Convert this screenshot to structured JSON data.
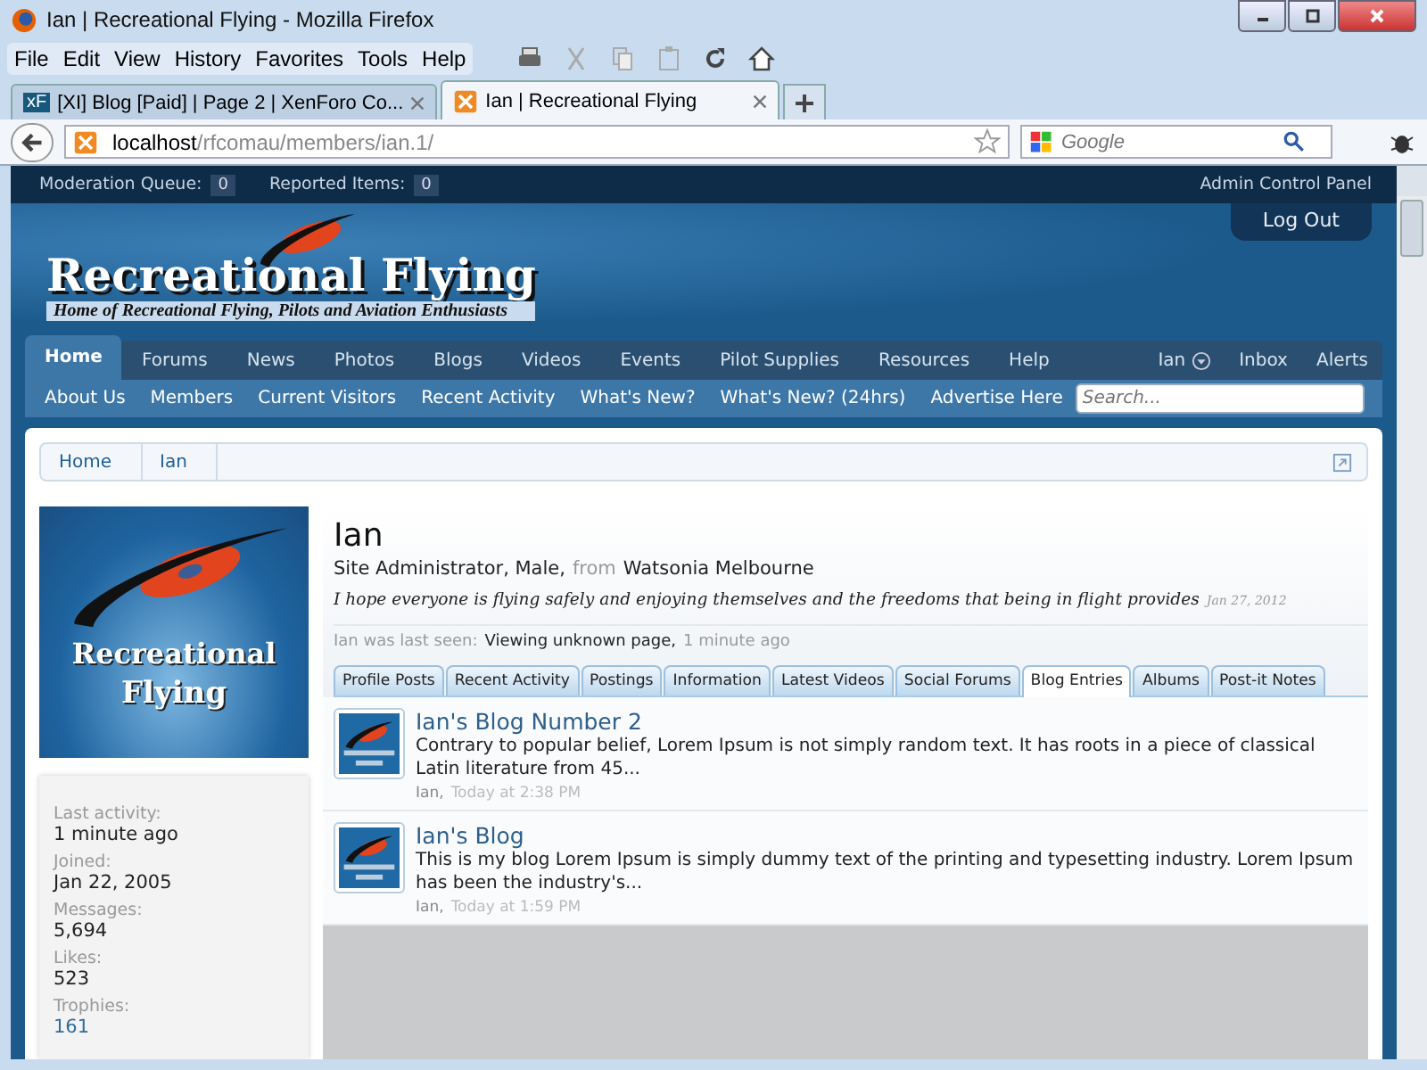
{
  "window": {
    "title": "Ian | Recreational Flying - Mozilla Firefox"
  },
  "menu": [
    "File",
    "Edit",
    "View",
    "History",
    "Favorites",
    "Tools",
    "Help"
  ],
  "browser_tabs": [
    {
      "label": "[XI] Blog [Paid] | Page 2 | XenForo Co...",
      "selected": false,
      "icon_text": "xF"
    },
    {
      "label": "Ian | Recreational Flying",
      "selected": true
    }
  ],
  "address": {
    "host": "localhost",
    "path": "/rfcomau/members/ian.1/"
  },
  "web_search": {
    "placeholder": "Google"
  },
  "mod_bar": {
    "items": [
      {
        "label": "Moderation Queue:",
        "count": "0"
      },
      {
        "label": "Reported Items:",
        "count": "0"
      }
    ],
    "admin_link": "Admin Control Panel"
  },
  "logout": "Log Out",
  "logo": {
    "title": "Recreational Flying",
    "tagline": "Home of Recreational Flying, Pilots and Aviation Enthusiasts"
  },
  "nav": [
    {
      "label": "Home",
      "selected": true
    },
    {
      "label": "Forums",
      "selected": false
    },
    {
      "label": "News",
      "selected": false
    },
    {
      "label": "Photos",
      "selected": false
    },
    {
      "label": "Blogs",
      "selected": false
    },
    {
      "label": "Videos",
      "selected": false
    },
    {
      "label": "Events",
      "selected": false
    },
    {
      "label": "Pilot Supplies",
      "selected": false
    },
    {
      "label": "Resources",
      "selected": false
    },
    {
      "label": "Help",
      "selected": false
    }
  ],
  "nav_right": [
    {
      "label": "Ian",
      "kind": "menu"
    },
    {
      "label": "Inbox",
      "kind": "link"
    },
    {
      "label": "Alerts",
      "kind": "link"
    }
  ],
  "sub_nav": [
    "About Us",
    "Members",
    "Current Visitors",
    "Recent Activity",
    "What's New?",
    "What's New? (24hrs)",
    "Advertise Here"
  ],
  "site_search": {
    "placeholder": "Search..."
  },
  "breadcrumb": [
    "Home",
    "Ian"
  ],
  "avatar": {
    "line_1": "Recreational",
    "line_2": "Flying"
  },
  "stats": [
    {
      "label": "Last activity:",
      "value": "1 minute ago",
      "kind": "text"
    },
    {
      "label": "Joined:",
      "value": "Jan 22, 2005",
      "kind": "text"
    },
    {
      "label": "Messages:",
      "value": "5,694",
      "kind": "text"
    },
    {
      "label": "Likes:",
      "value": "523",
      "kind": "text"
    },
    {
      "label": "Trophies:",
      "value": "161",
      "kind": "link"
    }
  ],
  "profile": {
    "name": "Ian",
    "title": "Site Administrator, Male,",
    "from_label": "from",
    "location": "Watsonia Melbourne",
    "status": "I hope everyone is flying safely and enjoying themselves and the freedoms that being in flight provides",
    "status_date": "Jan 27, 2012",
    "last_seen_label": "Ian was last seen:",
    "last_seen_activity": "Viewing unknown page,",
    "last_seen_time": "1 minute ago"
  },
  "tabs": [
    {
      "label": "Profile Posts",
      "selected": false
    },
    {
      "label": "Recent Activity",
      "selected": false
    },
    {
      "label": "Postings",
      "selected": false
    },
    {
      "label": "Information",
      "selected": false
    },
    {
      "label": "Latest Videos",
      "selected": false
    },
    {
      "label": "Social Forums",
      "selected": false
    },
    {
      "label": "Blog Entries",
      "selected": true
    },
    {
      "label": "Albums",
      "selected": false
    },
    {
      "label": "Post-it Notes",
      "selected": false
    }
  ],
  "entries": [
    {
      "title": "Ian's Blog Number 2",
      "snippet": "Contrary to popular belief, Lorem Ipsum is not simply random text. It has roots in a piece of classical Latin literature from 45...",
      "author": "Ian,",
      "time": "Today at 2:38 PM"
    },
    {
      "title": "Ian's Blog",
      "snippet": "This is my blog Lorem Ipsum is simply dummy text of the printing and typesetting industry. Lorem Ipsum has been the industry's...",
      "author": "Ian,",
      "time": "Today at 1:59 PM"
    }
  ]
}
